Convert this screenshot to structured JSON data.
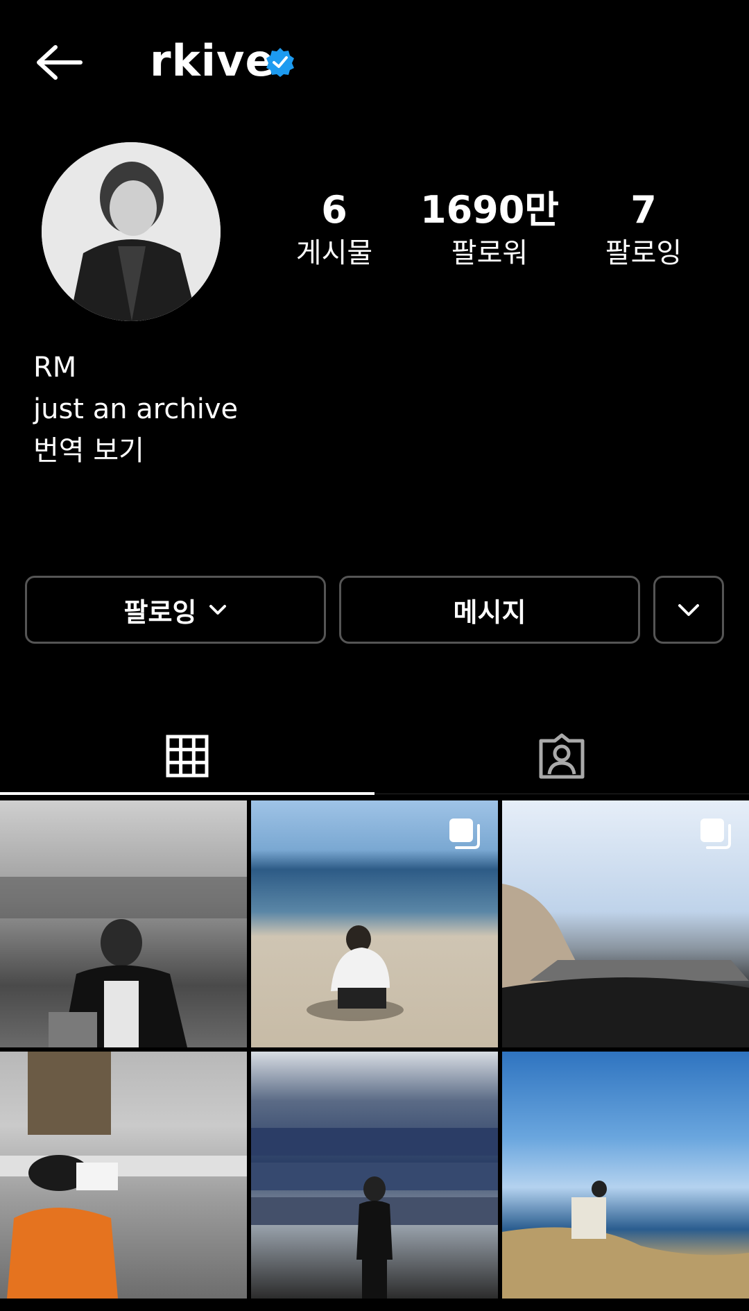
{
  "header": {
    "back_icon": "arrow-left-icon",
    "username": "rkive",
    "verified_icon": "verified-badge-icon",
    "verified_color": "#1d9bf0"
  },
  "stats": {
    "posts_count": "6",
    "posts_label": "게시물",
    "followers_count": "1690만",
    "followers_label": "팔로워",
    "following_count": "7",
    "following_label": "팔로잉"
  },
  "bio": {
    "name": "RM",
    "text": "just an archive",
    "translate": "번역 보기"
  },
  "actions": {
    "following_label": "팔로잉",
    "message_label": "메시지",
    "more_icon": "chevron-down-icon"
  },
  "tabs": {
    "grid_icon": "grid-icon",
    "tagged_icon": "tagged-person-icon",
    "active": "grid"
  },
  "posts": [
    {
      "description": "photo",
      "multi": false
    },
    {
      "description": "photo",
      "multi": true
    },
    {
      "description": "photo",
      "multi": true
    },
    {
      "description": "photo",
      "multi": false
    },
    {
      "description": "photo",
      "multi": false
    },
    {
      "description": "photo",
      "multi": false
    }
  ]
}
